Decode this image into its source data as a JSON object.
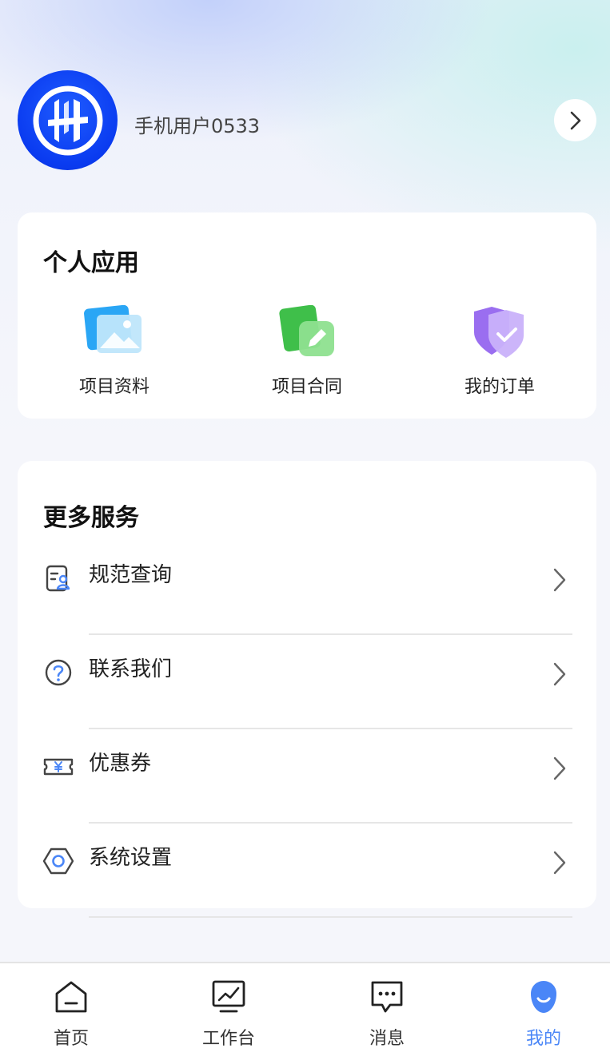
{
  "profile": {
    "username": "手机用户0533",
    "icons": {
      "avatar": "brand-logo-icon",
      "arrow": "chevron-right-icon"
    }
  },
  "personal_apps": {
    "title": "个人应用",
    "items": [
      {
        "label": "项目资料",
        "icon": "image-gallery-icon"
      },
      {
        "label": "项目合同",
        "icon": "edit-document-icon"
      },
      {
        "label": "我的订单",
        "icon": "shield-check-icon"
      }
    ]
  },
  "more_services": {
    "title": "更多服务",
    "items": [
      {
        "label": "规范查询",
        "icon": "contact-card-icon"
      },
      {
        "label": "联系我们",
        "icon": "question-circle-icon"
      },
      {
        "label": "优惠券",
        "icon": "ticket-yen-icon"
      },
      {
        "label": "系统设置",
        "icon": "settings-hexagon-icon"
      }
    ]
  },
  "tabbar": {
    "tabs": [
      {
        "label": "首页",
        "icon": "home-icon",
        "active": false
      },
      {
        "label": "工作台",
        "icon": "workbench-chart-icon",
        "active": false
      },
      {
        "label": "消息",
        "icon": "message-bubble-icon",
        "active": false
      },
      {
        "label": "我的",
        "icon": "user-face-icon",
        "active": true
      }
    ]
  },
  "colors": {
    "accent": "#4a86f7",
    "avatar_blue": "#0a3bf0",
    "text_primary": "#111111",
    "separator": "#e6e6e6"
  }
}
